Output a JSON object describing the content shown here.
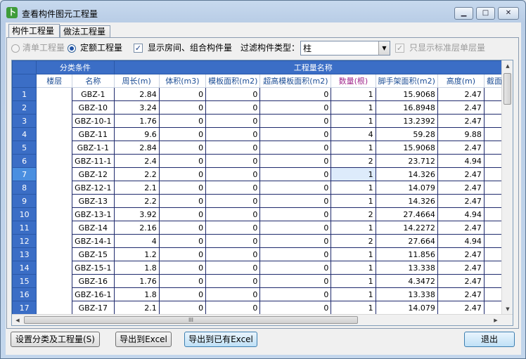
{
  "window": {
    "title": "查看构件图元工程量",
    "minimize": "▁",
    "maximize": "□",
    "close": "✕"
  },
  "tabs": [
    {
      "label": "构件工程量"
    },
    {
      "label": "做法工程量"
    }
  ],
  "filters": {
    "radio_bill": "清单工程量",
    "radio_quota": "定额工程量",
    "show_rooms": "显示房间、组合构件量",
    "filter_type_label": "过滤构件类型：",
    "filter_type_value": "柱",
    "standard_floor_only": "只显示标准层单层量"
  },
  "table": {
    "group_headers": {
      "category": "分类条件",
      "quantity": "工程量名称"
    },
    "columns": [
      "楼层",
      "名称",
      "周长(m)",
      "体积(m3)",
      "模板面积(m2)",
      "超高模板面积(m2)",
      "数量(根)",
      "脚手架面积(m2)",
      "高度(m)",
      "截面面"
    ],
    "rows": [
      {
        "n": "1",
        "floor": "",
        "name": "GBZ-1",
        "perimeter": "2.84",
        "volume": "0",
        "formwork": "0",
        "high_formwork": "0",
        "count": "1",
        "scaffold": "15.9068",
        "height": "2.47"
      },
      {
        "n": "2",
        "floor": "",
        "name": "GBZ-10",
        "perimeter": "3.24",
        "volume": "0",
        "formwork": "0",
        "high_formwork": "0",
        "count": "1",
        "scaffold": "16.8948",
        "height": "2.47"
      },
      {
        "n": "3",
        "floor": "",
        "name": "GBZ-10-1",
        "perimeter": "1.76",
        "volume": "0",
        "formwork": "0",
        "high_formwork": "0",
        "count": "1",
        "scaffold": "13.2392",
        "height": "2.47"
      },
      {
        "n": "4",
        "floor": "",
        "name": "GBZ-11",
        "perimeter": "9.6",
        "volume": "0",
        "formwork": "0",
        "high_formwork": "0",
        "count": "4",
        "scaffold": "59.28",
        "height": "9.88"
      },
      {
        "n": "5",
        "floor": "",
        "name": "GBZ-1-1",
        "perimeter": "2.84",
        "volume": "0",
        "formwork": "0",
        "high_formwork": "0",
        "count": "1",
        "scaffold": "15.9068",
        "height": "2.47"
      },
      {
        "n": "6",
        "floor": "",
        "name": "GBZ-11-1",
        "perimeter": "2.4",
        "volume": "0",
        "formwork": "0",
        "high_formwork": "0",
        "count": "2",
        "scaffold": "23.712",
        "height": "4.94"
      },
      {
        "n": "7",
        "floor": "",
        "name": "GBZ-12",
        "perimeter": "2.2",
        "volume": "0",
        "formwork": "0",
        "high_formwork": "0",
        "count": "1",
        "scaffold": "14.326",
        "height": "2.47"
      },
      {
        "n": "8",
        "floor": "",
        "name": "GBZ-12-1",
        "perimeter": "2.1",
        "volume": "0",
        "formwork": "0",
        "high_formwork": "0",
        "count": "1",
        "scaffold": "14.079",
        "height": "2.47"
      },
      {
        "n": "9",
        "floor": "",
        "name": "GBZ-13",
        "perimeter": "2.2",
        "volume": "0",
        "formwork": "0",
        "high_formwork": "0",
        "count": "1",
        "scaffold": "14.326",
        "height": "2.47"
      },
      {
        "n": "10",
        "floor": "",
        "name": "GBZ-13-1",
        "perimeter": "3.92",
        "volume": "0",
        "formwork": "0",
        "high_formwork": "0",
        "count": "2",
        "scaffold": "27.4664",
        "height": "4.94"
      },
      {
        "n": "11",
        "floor": "",
        "name": "GBZ-14",
        "perimeter": "2.16",
        "volume": "0",
        "formwork": "0",
        "high_formwork": "0",
        "count": "1",
        "scaffold": "14.2272",
        "height": "2.47"
      },
      {
        "n": "12",
        "floor": "",
        "name": "GBZ-14-1",
        "perimeter": "4",
        "volume": "0",
        "formwork": "0",
        "high_formwork": "0",
        "count": "2",
        "scaffold": "27.664",
        "height": "4.94"
      },
      {
        "n": "13",
        "floor": "",
        "name": "GBZ-15",
        "perimeter": "1.2",
        "volume": "0",
        "formwork": "0",
        "high_formwork": "0",
        "count": "1",
        "scaffold": "11.856",
        "height": "2.47"
      },
      {
        "n": "14",
        "floor": "",
        "name": "GBZ-15-1",
        "perimeter": "1.8",
        "volume": "0",
        "formwork": "0",
        "high_formwork": "0",
        "count": "1",
        "scaffold": "13.338",
        "height": "2.47"
      },
      {
        "n": "15",
        "floor": "",
        "name": "GBZ-16",
        "perimeter": "1.76",
        "volume": "0",
        "formwork": "0",
        "high_formwork": "0",
        "count": "1",
        "scaffold": "4.3472",
        "height": "2.47"
      },
      {
        "n": "16",
        "floor": "",
        "name": "GBZ-16-1",
        "perimeter": "1.8",
        "volume": "0",
        "formwork": "0",
        "high_formwork": "0",
        "count": "1",
        "scaffold": "13.338",
        "height": "2.47"
      },
      {
        "n": "17",
        "floor": "",
        "name": "GBZ-17",
        "perimeter": "2.1",
        "volume": "0",
        "formwork": "0",
        "high_formwork": "0",
        "count": "1",
        "scaffold": "14.079",
        "height": "2.47"
      }
    ],
    "selected_row": "7",
    "hscroll_grip": "III"
  },
  "buttons": {
    "setup": "设置分类及工程量(S)",
    "export_excel": "导出到Excel",
    "export_existing": "导出到已有Excel",
    "exit": "退出"
  },
  "colors": {
    "header_blue": "#3b6ec6",
    "grid_line": "#1f2a6d",
    "selected_header": "#a0288c"
  }
}
